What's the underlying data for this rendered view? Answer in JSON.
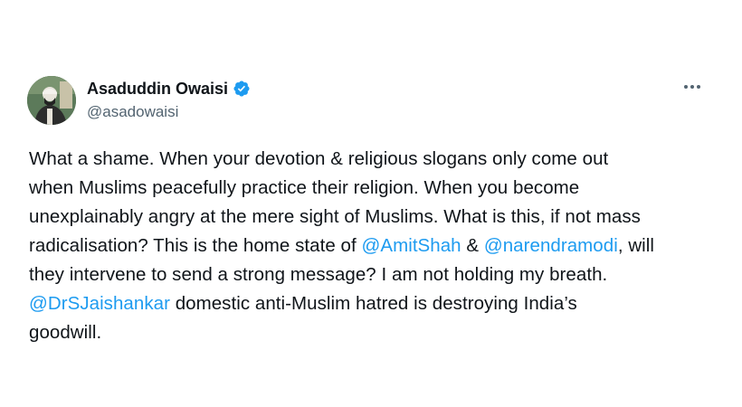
{
  "author": {
    "display_name": "Asaduddin Owaisi",
    "handle": "@asadowaisi",
    "verified": true,
    "verified_icon": "verified-badge-icon"
  },
  "more_icon": "more-horizontal-icon",
  "tweet": {
    "lines": [
      [
        {
          "text": "What a shame. When your devotion & religious slogans only come out"
        }
      ],
      [
        {
          "text": "when Muslims peacefully practice their religion. When you become"
        }
      ],
      [
        {
          "text": "unexplainably angry at the mere sight of Muslims. What is this, if not mass"
        }
      ],
      [
        {
          "text": "radicalisation? This is the home state of "
        },
        {
          "text": "@AmitShah",
          "mention": true
        },
        {
          "text": " & "
        },
        {
          "text": "@narendramodi",
          "mention": true
        },
        {
          "text": ", will"
        }
      ],
      [
        {
          "text": "they intervene to send a strong message? I am not holding my breath."
        }
      ],
      [
        {
          "text": "@DrSJaishankar",
          "mention": true
        },
        {
          "text": " domestic anti-Muslim hatred is destroying India’s"
        }
      ],
      [
        {
          "text": "goodwill."
        }
      ]
    ]
  },
  "colors": {
    "text": "#0f1419",
    "secondary": "#536471",
    "link": "#1d9bf0",
    "verified": "#1d9bf0"
  }
}
